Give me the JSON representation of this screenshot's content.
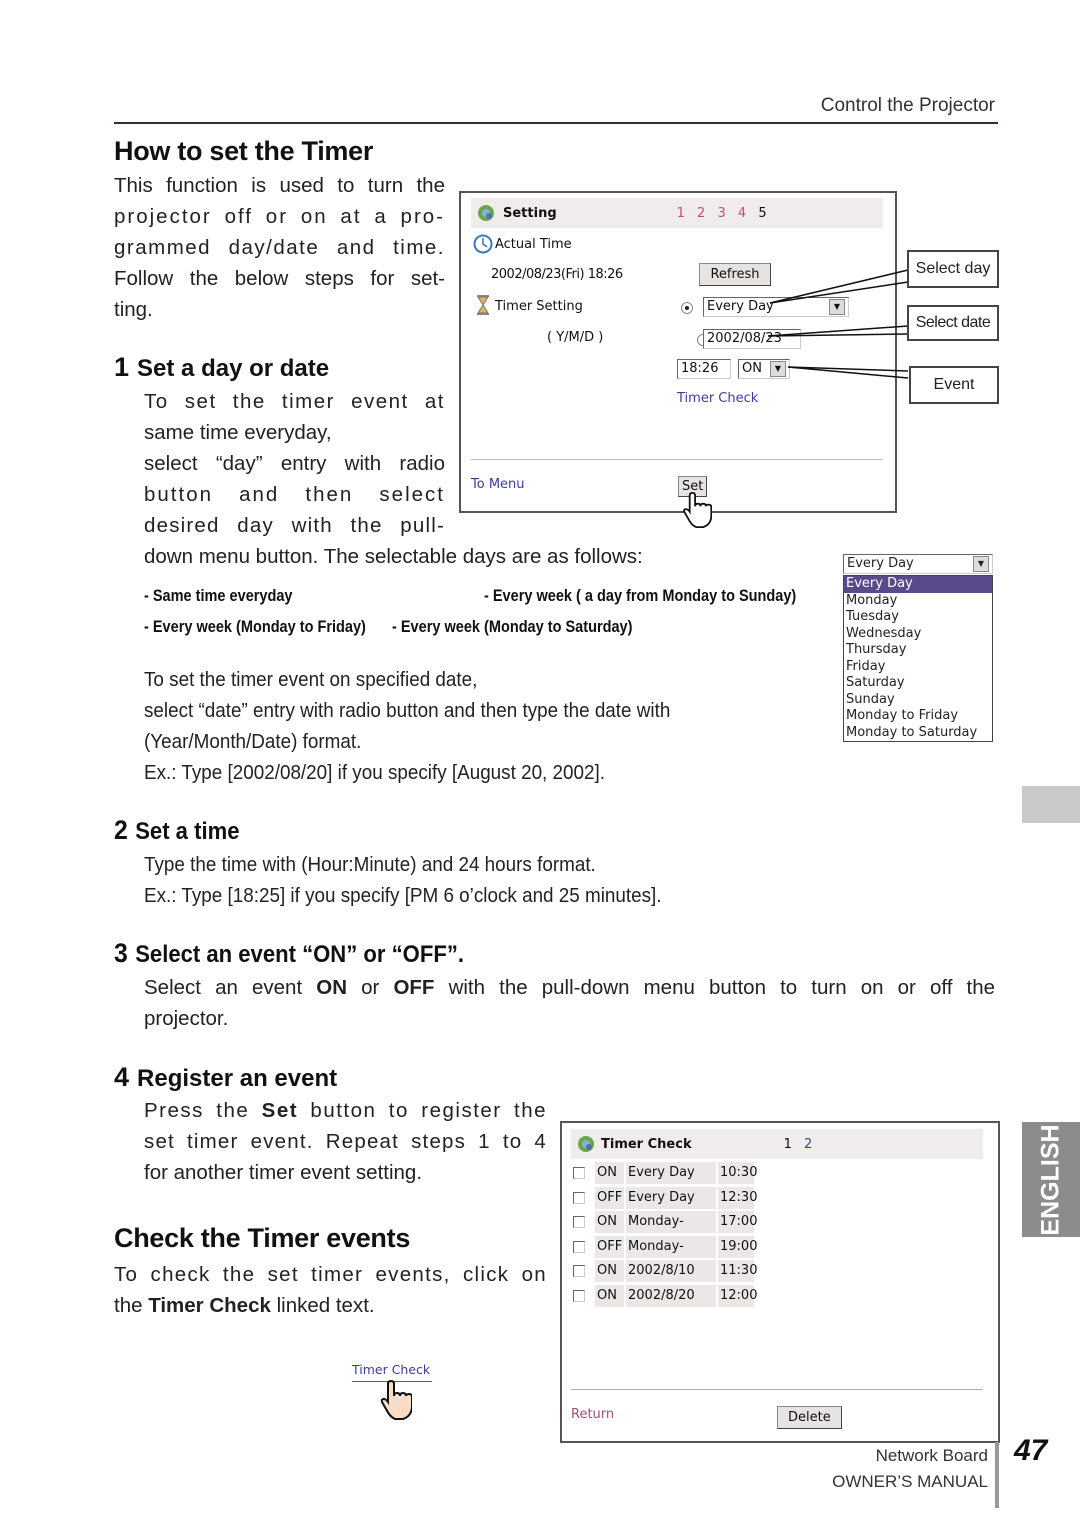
{
  "header": {
    "section": "Control the Projector"
  },
  "intro": {
    "title": "How to set the Timer",
    "lines": [
      "This function is used to turn the",
      "projector off or on at a pro-",
      "grammed day/date and time.",
      "Follow the below steps for set-",
      "ting."
    ]
  },
  "step1": {
    "num": "1",
    "title": "Set a day or date",
    "lines": [
      "To set the timer event at",
      "same time everyday,",
      "select “day” entry with radio",
      "button and then select",
      "desired day with the pull-"
    ],
    "line_wide": "down menu button. The selectable days are as follows:",
    "options_list": [
      "- Same time everyday",
      "- Every week ( a day from Monday to Sunday)",
      "- Every week (Monday to Friday)",
      "- Every week (Monday to Saturday)"
    ],
    "date_lines": [
      "To set the timer event on specified date,",
      "select “date” entry with radio button and then type the date with",
      "(Year/Month/Date) format."
    ],
    "example": "Ex.: Type [2002/08/20] if you specify [August 20, 2002]."
  },
  "step2": {
    "num": "2",
    "title": "Set a time",
    "lines": [
      "Type the time with (Hour:Minute) and 24 hours format.",
      "Ex.: Type [18:25] if you specify [PM 6 o’clock and 25 minutes]."
    ]
  },
  "step3": {
    "num": "3",
    "title": "Select an event “ON” or “OFF”.",
    "pre": "Select an event ",
    "on": "ON",
    "mid": " or ",
    "off": "OFF",
    "post": " with the pull-down menu button to turn on or off the",
    "line2": "projector."
  },
  "step4": {
    "num": "4",
    "title": "Register an event",
    "l1_pre": "Press the ",
    "l1_bold": "Set",
    "l1_post": " button to register the",
    "l2": "set timer event. Repeat steps 1 to 4",
    "l3": "for another timer event setting."
  },
  "check": {
    "title": "Check the Timer events",
    "l1": "To check the set timer events, click on",
    "l2_pre": "the ",
    "l2_bold": "Timer Check",
    "l2_post": " linked text.",
    "link_illustration": "Timer Check"
  },
  "setting_panel": {
    "title": "Setting",
    "pages": [
      "1",
      "2",
      "3",
      "4",
      "5"
    ],
    "current_page": "5",
    "actual_time_label": "Actual Time",
    "actual_time_value": "2002/08/23(Fri) 18:26",
    "refresh_label": "Refresh",
    "timer_setting_label": "Timer Setting",
    "ymd_label": "( Y/M/D )",
    "day_select_value": "Every Day",
    "date_input_value": "2002/08/23",
    "day_radio_selected": true,
    "time_input_value": "18:26",
    "event_select_value": "ON",
    "timer_check_link": "Timer Check",
    "to_menu_link": "To Menu",
    "set_label": "Set"
  },
  "callouts": {
    "select_day": "Select day",
    "select_date": "Select date",
    "event": "Event"
  },
  "dropdown": {
    "current": "Every Day",
    "options": [
      "Every Day",
      "Monday",
      "Tuesday",
      "Wednesday",
      "Thursday",
      "Friday",
      "Saturday",
      "Sunday",
      "Monday to Friday",
      "Monday to Saturday"
    ],
    "highlighted": "Every Day"
  },
  "timer_check_panel": {
    "title": "Timer Check",
    "pages": [
      "1",
      "2"
    ],
    "current_page": "1",
    "rows": [
      {
        "event": "ON",
        "when": "Every Day",
        "time": "10:30"
      },
      {
        "event": "OFF",
        "when": "Every Day",
        "time": "12:30"
      },
      {
        "event": "ON",
        "when": "Monday-Friday",
        "time": "17:00"
      },
      {
        "event": "OFF",
        "when": "Monday-Friday",
        "time": "19:00"
      },
      {
        "event": "ON",
        "when": "2002/8/10",
        "time": "11:30"
      },
      {
        "event": "ON",
        "when": "2002/8/20",
        "time": "12:00"
      }
    ],
    "return_link": "Return",
    "delete_label": "Delete"
  },
  "footer": {
    "line1": "Network Board",
    "line2": "OWNER’S MANUAL",
    "page_number": "47"
  },
  "side_tab": {
    "language": "ENGLISH"
  }
}
